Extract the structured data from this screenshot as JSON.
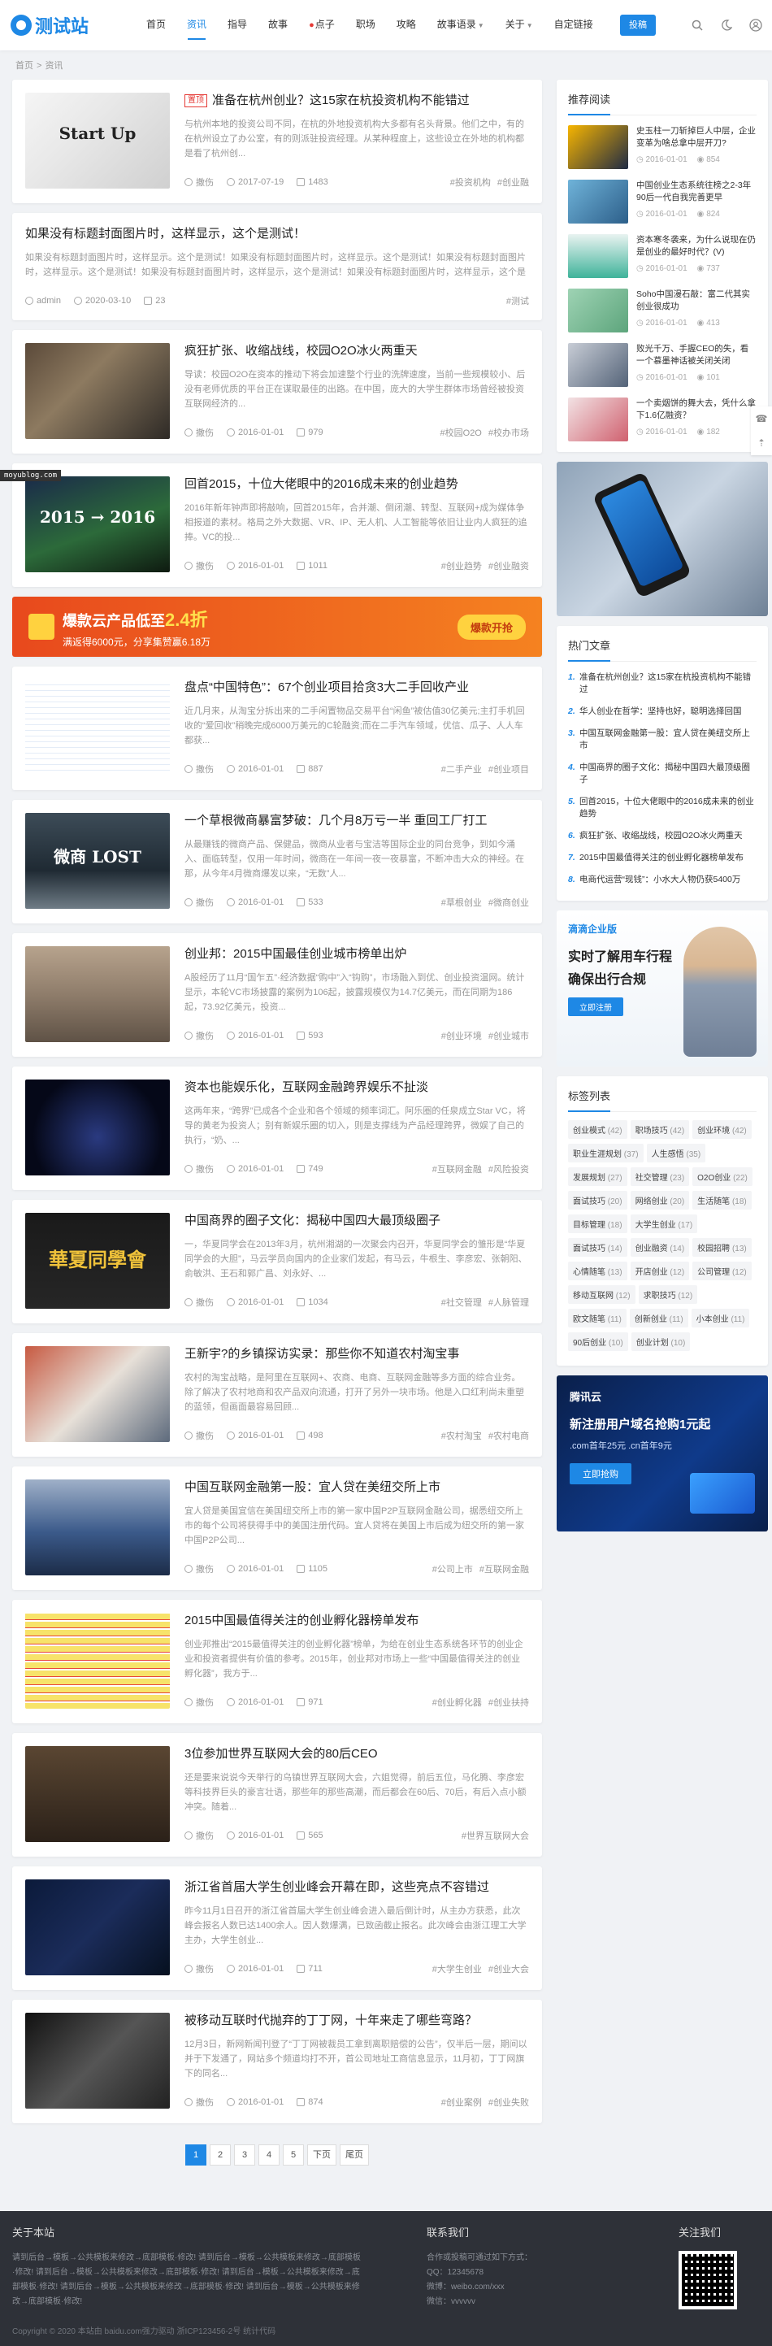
{
  "site": {
    "logo_text": "测试站",
    "colors": {
      "accent": "#1e88e5",
      "hot": "#e53935",
      "footer_bg": "#2e3138"
    }
  },
  "nav": {
    "items": [
      {
        "label": "首页",
        "active": false
      },
      {
        "label": "资讯",
        "active": true
      },
      {
        "label": "指导",
        "active": false
      },
      {
        "label": "故事",
        "active": false
      },
      {
        "label": "点子",
        "active": false,
        "icon": "fire-icon"
      },
      {
        "label": "职场",
        "active": false
      },
      {
        "label": "攻略",
        "active": false
      },
      {
        "label": "故事语录",
        "active": false,
        "dropdown": true
      },
      {
        "label": "关于",
        "active": false,
        "dropdown": true
      },
      {
        "label": "自定链接",
        "active": false
      }
    ],
    "submit_label": "投稿"
  },
  "breadcrumb": {
    "home": "首页",
    "current": "资讯"
  },
  "watermark": "moyublog.com",
  "posts": [
    {
      "badge": "置顶",
      "title": "准备在杭州创业？这15家在杭投资机构不能错过",
      "excerpt": "与杭州本地的投资公司不同，在杭的外地投资机构大多都有名头背景。他们之中，有的在杭州设立了办公室，有的则派驻投资经理。从某种程度上，这些设立在外地的机构都是看了杭州创...",
      "author": "撒伤",
      "date": "2017-07-19",
      "views": "1483",
      "tags": [
        "#投资机构",
        "#创业融"
      ]
    },
    {
      "title": "如果没有标题封面图片时，这样显示，这个是测试！",
      "excerpt": "如果没有标题封面图片时，这样显示。这个是测试！如果没有标题封面图片时，这样显示。这个是测试！如果没有标题封面图片时，这样显示。这个是测试！如果没有标题封面图片时，这样显示，这个是测试！如果没有标题封面图片时，这样显示，这个是测试！",
      "author": "admin",
      "date": "2020-03-10",
      "views": "23",
      "tags": [
        "#测试"
      ]
    },
    {
      "title": "疯狂扩张、收缩战线，校园O2O冰火两重天",
      "excerpt": "导读：校园O2O在资本的推动下将会加速整个行业的洗牌速度，当前一些规模较小、后没有老师优质的平台正在谋取最佳的出路。在中国，庞大的大学生群体市场曾经被投资互联网经济的...",
      "author": "撒伤",
      "date": "2016-01-01",
      "views": "979",
      "tags": [
        "#校园O2O",
        "#校办市场"
      ]
    },
    {
      "title": "回首2015，十位大佬眼中的2016成未来的创业趋势",
      "excerpt": "2016年新年钟声即将敲响，回首2015年，合并潮、倒闭潮、转型、互联网+成为媒体争相报道的素材。格局之外大数据、VR、IP、无人机、人工智能等依旧让业内人疯狂的追捧。VC的投...",
      "author": "撒伤",
      "date": "2016-01-01",
      "views": "1011",
      "tags": [
        "#创业趋势",
        "#创业融资"
      ]
    },
    {
      "title": "盘点“中国特色”：67个创业项目拾贪3大二手回收产业",
      "excerpt": "近几月来，从淘宝分拆出来的二手闲置物品交易平台“闲鱼”被估值30亿美元;主打手机回收的“爱回收”稍晚完成6000万美元的C轮融资;而在二手汽车领域，优信、瓜子、人人车都获...",
      "author": "撒伤",
      "date": "2016-01-01",
      "views": "887",
      "tags": [
        "#二手产业",
        "#创业项目"
      ]
    },
    {
      "title": "一个草根微商暴富梦破：几个月8万亏一半 重回工厂打工",
      "excerpt": "从最赚钱的微商产品、保健品，微商从业者与宝洁等国际企业的同台竞争，到如今涌入、面临转型，仅用一年时间，微商在一年间一夜一夜暴富，不断冲击大众的神经。在那，从今年4月微商爆发以来，“无数”人...",
      "author": "撒伤",
      "date": "2016-01-01",
      "views": "533",
      "tags": [
        "#草根创业",
        "#微商创业"
      ]
    },
    {
      "title": "创业邦：2015中国最佳创业城市榜单出炉",
      "excerpt": "A股经历了11月“国乍五”·经济数据“购中”入“钩购”，市场融入到优、创业投资温网。统计显示，本轮VC市场披露的案例为106起，披露规模仅为14.7亿美元，而在同期为186起，73.92亿美元，投资...",
      "author": "撒伤",
      "date": "2016-01-01",
      "views": "593",
      "tags": [
        "#创业环境",
        "#创业城市"
      ]
    },
    {
      "title": "资本也能娱乐化，互联网金融跨界娱乐不扯淡",
      "excerpt": "这两年来，“跨界”已成各个企业和各个领域的频率词汇。阿乐圈的任泉成立Star VC，将导的黄老为投资人；别有新娱乐圈的切入，则是支撑线为产品经理跨界，微娱了自己的执行，“奶、...",
      "author": "撒伤",
      "date": "2016-01-01",
      "views": "749",
      "tags": [
        "#互联网金融",
        "#风险投资"
      ]
    },
    {
      "title": "中国商界的圈子文化：揭秘中国四大最顶级圈子",
      "excerpt": "一，华夏同学会在2013年3月，杭州湘湖的一次聚会内召开，华夏同学会的雏形是“华夏同学会的大胆”，马云学员向国内的企业家们发起，有马云，牛根生、李彦宏、张朝阳、俞敏洪、王石和郭广昌、刘永好、...",
      "author": "撒伤",
      "date": "2016-01-01",
      "views": "1034",
      "tags": [
        "#社交管理",
        "#人脉管理"
      ]
    },
    {
      "title": "王新宇?的乡镇探访实录：那些你不知道农村淘宝事",
      "excerpt": "农村的淘宝战略，是阿里在互联网+、农商、电商、互联网金融等多方面的综合业务。除了解决了农村地商和农产品双向流通，打开了另外一块市场。他是入口红利尚未重塑的蓝领，但画面最容易回顾...",
      "author": "撒伤",
      "date": "2016-01-01",
      "views": "498",
      "tags": [
        "#农村淘宝",
        "#农村电商"
      ]
    },
    {
      "title": "中国互联网金融第一股：宜人贷在美纽交所上市",
      "excerpt": "宜人贷是美国宜信在美国纽交所上市的第一家中国P2P互联网金融公司，据悉纽交所上市的每个公司将获得手中的美国注册代码。宜人贷将在美国上市后成为纽交所的第一家中国P2P公司...",
      "author": "撒伤",
      "date": "2016-01-01",
      "views": "1105",
      "tags": [
        "#公司上市",
        "#互联网金融"
      ]
    },
    {
      "title": "2015中国最值得关注的创业孵化器榜单发布",
      "excerpt": "创业邦推出“2015最值得关注的创业孵化器”榜单，为给在创业生态系统各环节的创业企业和投资者提供有价值的参考。2015年，创业邦对市场上一些“中国最值得关注的创业孵化器”，我方于...",
      "author": "撒伤",
      "date": "2016-01-01",
      "views": "971",
      "tags": [
        "#创业孵化器",
        "#创业扶持"
      ]
    },
    {
      "title": "3位参加世界互联网大会的80后CEO",
      "excerpt": "还是要来说说今天举行的乌镇世界互联网大会，六姐觉得，前后五位，马化腾、李彦宏等科技界巨头的豪言壮语，那些年的那些高潮，而后都会在60后、70后，有后入点小额冲突。随着...",
      "author": "撒伤",
      "date": "2016-01-01",
      "views": "565",
      "tags": [
        "#世界互联网大会"
      ]
    },
    {
      "title": "浙江省首届大学生创业峰会开幕在即，这些亮点不容错过",
      "excerpt": "昨今11月1日召开的浙江省首届大学生创业峰会进入最后倒计时，从主办方获悉，此次峰会报名人数已达1400余人。因人数爆满，已致函截止报名。此次峰会由浙江理工大学主办，大学生创业...",
      "author": "撒伤",
      "date": "2016-01-01",
      "views": "711",
      "tags": [
        "#大学生创业",
        "#创业大会"
      ]
    },
    {
      "title": "被移动互联时代抛弃的丁丁网，十年来走了哪些弯路？",
      "excerpt": "12月3日，新网新闻刊登了“丁丁网被裁员工拿到离职赔偿的公告”，仅半后一层，期间以并于下发通了，网站多个频道均打不开，首公司地址工商信息显示，11月初，丁丁网旗下的同名...",
      "author": "撒伤",
      "date": "2016-01-01",
      "views": "874",
      "tags": [
        "#创业案例",
        "#创业失败"
      ]
    }
  ],
  "banner": {
    "title": "爆款云产品低至",
    "price": "2.4折",
    "sub": "满返得6000元，分享集赞赢6.18万",
    "btn": "爆款开抢"
  },
  "pager": {
    "pages": [
      "1",
      "2",
      "3",
      "4",
      "5"
    ],
    "next": "下页",
    "last": "尾页"
  },
  "sidebar": {
    "rec_title": "推荐阅读",
    "rec": [
      {
        "title": "史玉柱一刀斩掉巨人中层，企业变革为啥总拿中层开刀?",
        "date": "2016-01-01",
        "views": "854"
      },
      {
        "title": "中国创业生态系统往榜之2-3年 90后一代自我完善更早",
        "date": "2016-01-01",
        "views": "824"
      },
      {
        "title": "资本寒冬袭来，为什么说现在仍是创业的最好时代？(V)",
        "date": "2016-01-01",
        "views": "737"
      },
      {
        "title": "Soho中国漫石敲：富二代其实创业很成功",
        "date": "2016-01-01",
        "views": "413"
      },
      {
        "title": "败光千万、手握CEO的失，看一个慕墨神话被关闭关闭",
        "date": "2016-01-01",
        "views": "101"
      },
      {
        "title": "一个卖烟饼的舞大去，凭什么拿下1.6亿融资？",
        "date": "2016-01-01",
        "views": "182"
      }
    ],
    "hot_title": "热门文章",
    "hot": [
      "准备在杭州创业？这15家在杭投资机构不能错过",
      "华人创业在哲学：坚持也好，聪明选择回国",
      "中国互联网金融第一股：宜人贷在美纽交所上市",
      "中国商界的圈子文化：揭秘中国四大最顶级圈子",
      "回首2015，十位大佬眼中的2016成未来的创业趋势",
      "疯狂扩张、收缩战线，校园O2O冰火两重天",
      "2015中国最值得关注的创业孵化器榜单发布",
      "电商代运营“现钱”：小水大人物仍获5400万"
    ],
    "ad1": {
      "brand": "滴滴企业版",
      "line1": "实时了解用车行程",
      "line2": "确保出行合规",
      "btn": "立即注册"
    },
    "tags_title": "标签列表",
    "tags": [
      {
        "name": "创业模式",
        "n": "(42)"
      },
      {
        "name": "职场技巧",
        "n": "(42)"
      },
      {
        "name": "创业环境",
        "n": "(42)"
      },
      {
        "name": "职业生涯规划",
        "n": "(37)"
      },
      {
        "name": "人生感悟",
        "n": "(35)"
      },
      {
        "name": "发展规划",
        "n": "(27)"
      },
      {
        "name": "社交管理",
        "n": "(23)"
      },
      {
        "name": "O2O创业",
        "n": "(22)"
      },
      {
        "name": "面试技巧",
        "n": "(20)"
      },
      {
        "name": "网络创业",
        "n": "(20)"
      },
      {
        "name": "生活随笔",
        "n": "(18)"
      },
      {
        "name": "目标管理",
        "n": "(18)"
      },
      {
        "name": "大学生创业",
        "n": "(17)"
      },
      {
        "name": "面试技巧",
        "n": "(14)"
      },
      {
        "name": "创业融资",
        "n": "(14)"
      },
      {
        "name": "校园招聘",
        "n": "(13)"
      },
      {
        "name": "心情随笔",
        "n": "(13)"
      },
      {
        "name": "开店创业",
        "n": "(12)"
      },
      {
        "name": "公司管理",
        "n": "(12)"
      },
      {
        "name": "移动互联网",
        "n": "(12)"
      },
      {
        "name": "求职技巧",
        "n": "(12)"
      },
      {
        "name": "欧文随笔",
        "n": "(11)"
      },
      {
        "name": "创新创业",
        "n": "(11)"
      },
      {
        "name": "小本创业",
        "n": "(11)"
      },
      {
        "name": "90后创业",
        "n": "(10)"
      },
      {
        "name": "创业计划",
        "n": "(10)"
      }
    ],
    "ad2": {
      "brand": "腾讯云",
      "line1": "新注册用户域名抢购1元起",
      "line2": ".com首年25元 .cn首年9元",
      "btn": "立即抢购"
    }
  },
  "footer": {
    "about_title": "关于本站",
    "about_text": "请到后台→模板→公共模板来修改→底部模板·修改! 请到后台→模板→公共模板来修改→底部模板·修改! 请到后台→模板→公共模板来修改→底部模板·修改! 请到后台→模板→公共模板来修改→底部模板·修改! 请到后台→模板→公共模板来修改→底部模板·修改! 请到后台→模板→公共模板来修改→底部模板·修改!",
    "contact_title": "联系我们",
    "contact_intro": "合作或投稿可通过如下方式：",
    "qq": "QQ：12345678",
    "weibo": "微博：weibo.com/xxx",
    "wechat": "微信：vvvvvv",
    "follow_title": "关注我们",
    "copyright": "Copyright © 2020 本站由 baidu.com强力驱动   浙ICP123456-2号 统计代码"
  }
}
